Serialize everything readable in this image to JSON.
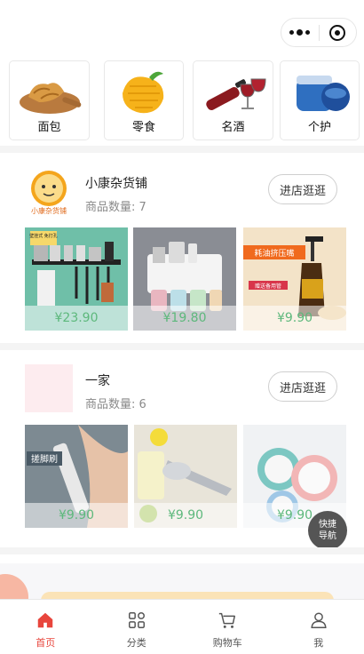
{
  "categories": [
    {
      "label": "面包",
      "icon": "bread-icon"
    },
    {
      "label": "零食",
      "icon": "mango-icon"
    },
    {
      "label": "名酒",
      "icon": "wine-icon"
    },
    {
      "label": "个护",
      "icon": "cream-jar-icon"
    }
  ],
  "shops": [
    {
      "name": "小康杂货铺",
      "logo_text": "小康杂货铺",
      "count_label": "商品数量: 7",
      "enter_label": "进店逛逛",
      "products": [
        {
          "price": "¥23.90",
          "badge": "壁挂式 免打孔",
          "image": "kitchen-rack"
        },
        {
          "price": "¥19.80",
          "image": "toothbrush-holder"
        },
        {
          "price": "¥9.90",
          "badge": "耗油挤压嘴",
          "badge2": "赠送备用管",
          "image": "oil-pump"
        }
      ]
    },
    {
      "name": "一家",
      "count_label": "商品数量: 6",
      "enter_label": "进店逛逛",
      "products": [
        {
          "price": "¥9.90",
          "badge": "搓脚刷",
          "image": "foot-scrubber"
        },
        {
          "price": "¥9.90",
          "image": "lemon-squeezer"
        },
        {
          "price": "¥9.90",
          "image": "ceramic-drain-plate"
        }
      ]
    }
  ],
  "float_nav": {
    "line1": "快捷",
    "line2": "导航"
  },
  "tabs": [
    {
      "label": "首页",
      "icon": "home-icon",
      "active": true
    },
    {
      "label": "分类",
      "icon": "grid-icon",
      "active": false
    },
    {
      "label": "购物车",
      "icon": "cart-icon",
      "active": false
    },
    {
      "label": "我",
      "icon": "user-icon",
      "active": false
    }
  ],
  "colors": {
    "accent": "#e8453c",
    "price": "#5db87c"
  }
}
